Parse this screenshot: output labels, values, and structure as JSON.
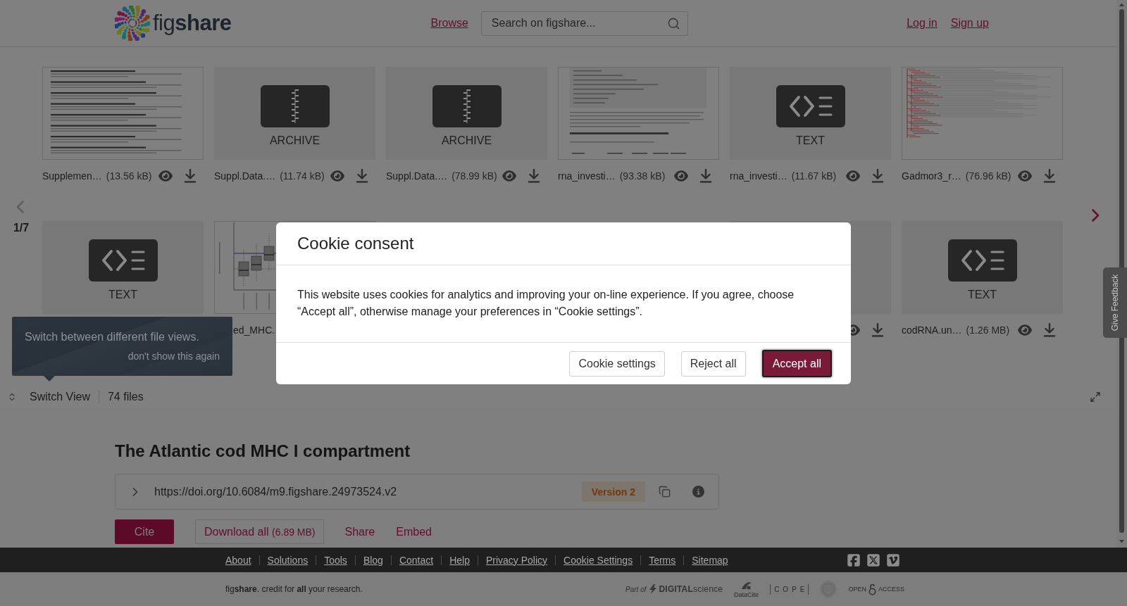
{
  "header": {
    "logo": "fig**share**",
    "browse_link": "Browse",
    "search": {
      "placeholder": "Search on figshare..."
    },
    "auth_links": [
      "Log in",
      "Sign up"
    ]
  },
  "file_viewer": {
    "pager": {
      "label": "1/7",
      "prev_disabled": true,
      "next_disabled": false
    },
    "files": [
      {
        "kind": "document",
        "label": {
          "kind": "full",
          "name": "Supplemen…",
          "size": "(13.56 kB)"
        }
      },
      {
        "kind": "archive",
        "type_label": "ARCHIVE",
        "label": {
          "kind": "full",
          "name": "Suppl.Data.…",
          "size": "(11.74 kB)"
        }
      },
      {
        "kind": "archive",
        "type_label": "ARCHIVE",
        "label": {
          "kind": "full",
          "name": "Suppl.Data.…",
          "size": "(78.99 kB)"
        }
      },
      {
        "kind": "code_document",
        "label": {
          "kind": "full",
          "name": "rna_investi…",
          "size": "(93.38 kB)"
        }
      },
      {
        "kind": "text",
        "type_label": "TEXT",
        "label": {
          "kind": "full",
          "name": "rna_investi…",
          "size": "(11.67 kB)"
        }
      },
      {
        "kind": "tree",
        "label": {
          "kind": "full",
          "name": "Gadmor3_r…",
          "size": "(76.96 kB)"
        }
      },
      {
        "kind": "text",
        "type_label": "TEXT"
      },
      {
        "kind": "boxplot",
        "label": {
          "kind": "clipped",
          "name": "ed_MHC."
        }
      },
      {
        "kind": "hidden"
      },
      {
        "kind": "hidden"
      },
      {
        "kind": "blank",
        "label": {
          "kind": "icons_only"
        }
      },
      {
        "kind": "text",
        "type_label": "TEXT",
        "label": {
          "kind": "full",
          "name": "codRNA.un…",
          "size": "(1.26 MB)"
        }
      }
    ],
    "switch_view": "Switch View",
    "file_count": "74 files",
    "tooltip": {
      "message": "Switch between different file views.",
      "dismiss": "don't show this again"
    }
  },
  "item": {
    "title": "The Atlantic cod MHC I compartment",
    "doi": "https://doi.org/10.6084/m9.figshare.24973524.v2",
    "version": "Version 2",
    "actions": [
      {
        "kind": "primary",
        "label": "Cite"
      },
      {
        "kind": "outline",
        "label": "Download all",
        "detail": "(6.89 MB)"
      },
      {
        "kind": "link",
        "label": "Share"
      },
      {
        "kind": "link",
        "label": "Embed"
      }
    ]
  },
  "footer": {
    "links": [
      "About",
      "Solutions",
      "Tools",
      "Blog",
      "Contact",
      "Help",
      "Privacy Policy",
      "Cookie Settings",
      "Terms",
      "Sitemap"
    ],
    "tagline": "fig**share**. credit for **all** your research.",
    "partners": [
      {
        "kind": "digital_science",
        "caption": "Part of",
        "name": "**DIGITAL**science"
      },
      {
        "kind": "datacite",
        "name": "DataCite"
      },
      {
        "kind": "cope",
        "name": "COPE"
      },
      {
        "kind": "seal"
      },
      {
        "kind": "open_access",
        "name": "OPEN",
        "suffix": "ACCESS"
      }
    ]
  },
  "feedback_tab": "Give Feedback",
  "cookie_dialog": {
    "title": "Cookie consent",
    "message": "This website uses cookies for analytics and improving your on-line experience. If you agree, choose “Accept all”, otherwise manage your preferences in “Cookie settings”.",
    "buttons": [
      {
        "kind": "secondary",
        "label": "Cookie settings",
        "focused": false
      },
      {
        "kind": "secondary",
        "label": "Reject all",
        "focused": false
      },
      {
        "kind": "primary",
        "label": "Accept all",
        "focused": true
      }
    ]
  }
}
